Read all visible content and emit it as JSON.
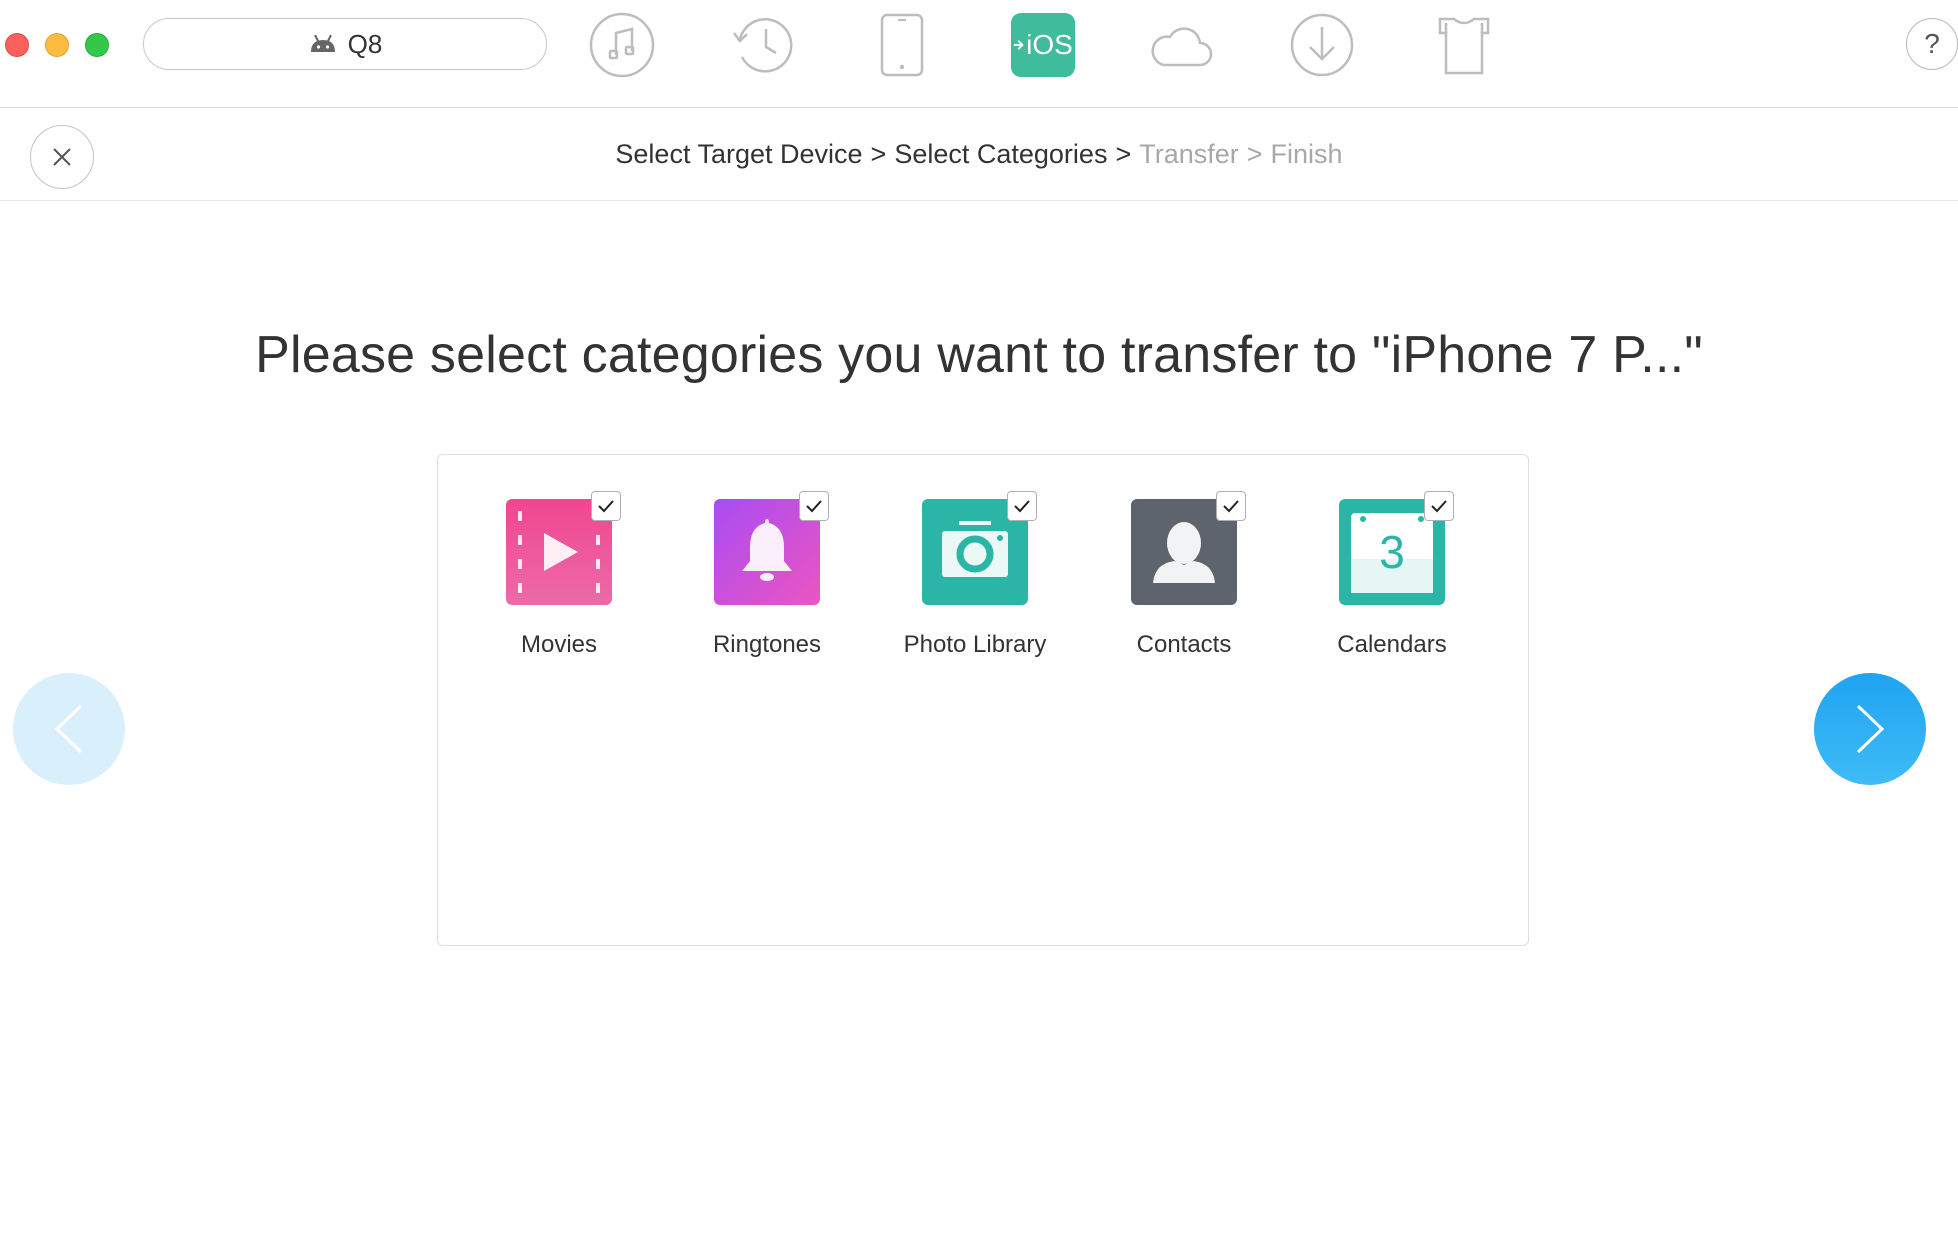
{
  "titlebar": {
    "device_name": "Q8",
    "tools": [
      {
        "name": "music-icon"
      },
      {
        "name": "history-icon"
      },
      {
        "name": "phone-icon"
      },
      {
        "name": "to-ios-icon",
        "label": "iOS",
        "active": true
      },
      {
        "name": "cloud-icon"
      },
      {
        "name": "download-icon"
      },
      {
        "name": "tshirt-icon"
      }
    ],
    "help_label": "?"
  },
  "steps": [
    {
      "label": "Select Target Device",
      "state": "done"
    },
    {
      "label": "Select Categories",
      "state": "done"
    },
    {
      "label": "Transfer",
      "state": "pending"
    },
    {
      "label": "Finish",
      "state": "pending"
    }
  ],
  "step_separator": ">",
  "heading": "Please select categories you want to transfer to \"iPhone 7 P...\"",
  "categories": [
    {
      "label": "Movies",
      "checked": true,
      "color": "#ec4f97"
    },
    {
      "label": "Ringtones",
      "checked": true,
      "color": "#b54ef2"
    },
    {
      "label": "Photo Library",
      "checked": true,
      "color": "#2bb5a7"
    },
    {
      "label": "Contacts",
      "checked": true,
      "color": "#5d646e"
    },
    {
      "label": "Calendars",
      "checked": true,
      "color": "#2bb5a7",
      "calendar_day": "3"
    }
  ],
  "colors": {
    "accent": "#3fbc9c",
    "next_button": "#29aef4",
    "prev_button": "#d9effc"
  }
}
